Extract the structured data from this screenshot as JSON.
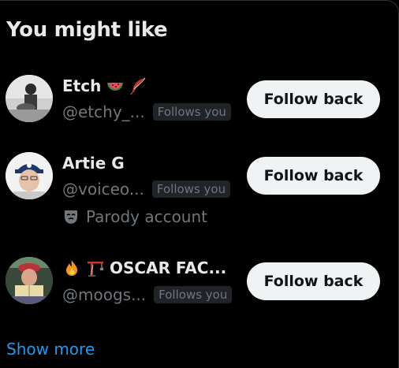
{
  "section": {
    "title": "You might like",
    "show_more": "Show more"
  },
  "users": [
    {
      "name": "Etch",
      "emoji_icons": [
        "watermelon-icon",
        "feather-icon"
      ],
      "handle": "@etchy_...",
      "follows_you": "Follows you",
      "button": "Follow back"
    },
    {
      "name": "Artie G",
      "emoji_icons": [],
      "handle": "@voiceo...",
      "follows_you": "Follows you",
      "parody": "Parody account",
      "button": "Follow back"
    },
    {
      "name": "OSCAR FAC...",
      "emoji_icons": [
        "fire-icon",
        "crane-icon"
      ],
      "handle": "@moogs...",
      "follows_you": "Follows you",
      "button": "Follow back"
    }
  ],
  "colors": {
    "background": "#000000",
    "text": "#e7e9ea",
    "secondary_text": "#71767b",
    "link": "#1d9bf0",
    "button_bg": "#eff3f4",
    "button_text": "#0f1419",
    "badge_bg": "#202327"
  }
}
